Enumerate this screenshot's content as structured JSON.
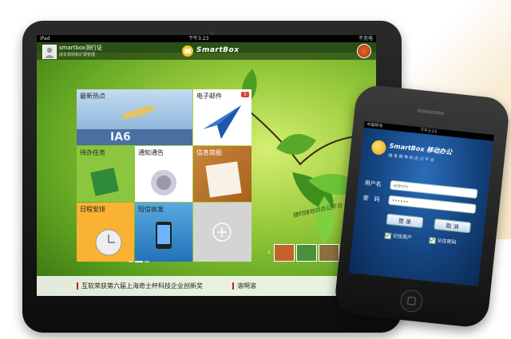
{
  "tablet": {
    "status": {
      "carrier": "iPad",
      "time": "下午3:23",
      "battery": "不充电"
    },
    "header": {
      "user_name": "smartbox测行证",
      "user_subtitle": "成长规则和扩展管理",
      "logo_text": "SmartBox"
    },
    "tiles": [
      {
        "label": "最新热点",
        "color": "#b6cfe8"
      },
      {
        "label": "电子邮件",
        "badge": "5",
        "color": "#ffffff"
      },
      {
        "label": "待办任务",
        "color": "#8cc63f"
      },
      {
        "label": "通知通告",
        "color": "#ffffff"
      },
      {
        "label": "信息简报",
        "color": "#f0a74a"
      },
      {
        "label": "日程安排",
        "color": "#f9b233"
      },
      {
        "label": "短信收发",
        "color": "#3a8fd0"
      },
      {
        "label": "+",
        "color": "#d9d9d9"
      }
    ],
    "hot_text": "IA6",
    "handwriting": "随时随地的办公平台",
    "ticker": [
      "互软荣获第六届上海奇士杯科技企业创新奖",
      "滚啊滚"
    ]
  },
  "phone": {
    "status": {
      "carrier": "中国移动",
      "time": "下午3:23"
    },
    "banner": {
      "title": "SmartBox 移动办公",
      "subtitle": "随 身 携 带 的 办 公 平 台"
    },
    "form": {
      "username_label": "用户名",
      "username_value": "admin",
      "password_label": "密　码",
      "password_value": "••••••",
      "login_button": "登 录",
      "cancel_button": "取 消",
      "remember_account": "记住用户",
      "remember_password": "记住密码"
    }
  },
  "colors": {
    "tablet_frame": "#111111",
    "screen_green": "#6fb32a",
    "phone_blue": "#14447f",
    "ticker_red": "#c52020"
  }
}
